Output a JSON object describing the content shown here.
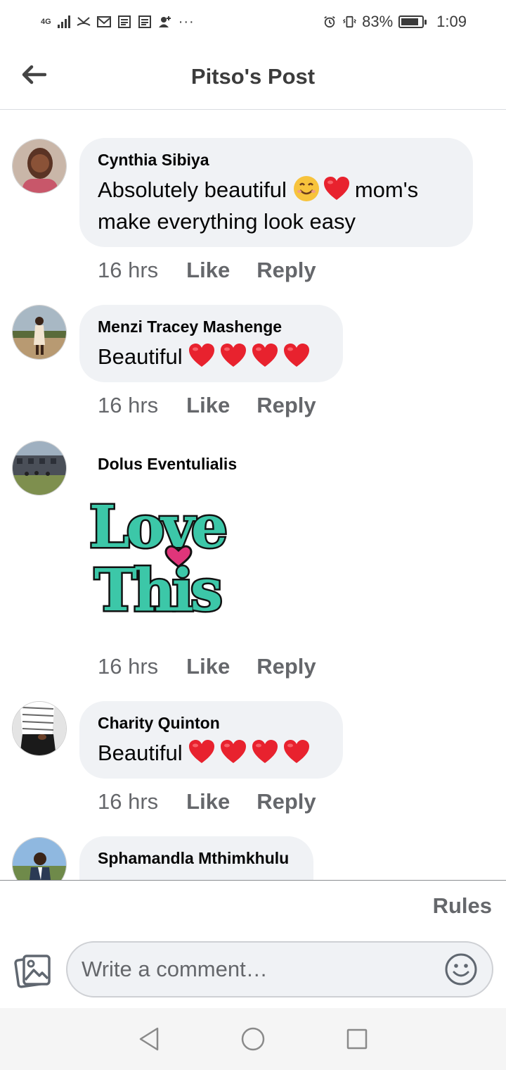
{
  "status_bar": {
    "network": "4G",
    "battery": "83%",
    "time": "1:09",
    "icons": [
      "signal-icon",
      "missed-call-icon",
      "mail-icon",
      "news-icon",
      "news-icon",
      "add-contact-icon",
      "more-icon",
      "alarm-icon",
      "vibrate-icon",
      "battery-icon"
    ]
  },
  "header": {
    "title": "Pitso's Post",
    "back_icon": "back-arrow-icon"
  },
  "comments": [
    {
      "author": "Cynthia Sibiya",
      "text_a": "Absolutely beautiful",
      "text_b": "mom's",
      "text_c": "make everything look easy",
      "time": "16 hrs",
      "like": "Like",
      "reply": "Reply"
    },
    {
      "author": "Menzi Tracey Mashenge",
      "text": "Beautiful",
      "time": "16 hrs",
      "like": "Like",
      "reply": "Reply"
    },
    {
      "author": "Dolus Eventulialis",
      "sticker_line1": "Love",
      "sticker_line2": "This",
      "time": "16 hrs",
      "like": "Like",
      "reply": "Reply"
    },
    {
      "author": "Charity Quinton",
      "text": "Beautiful",
      "time": "16 hrs",
      "like": "Like",
      "reply": "Reply"
    },
    {
      "author": "Sphamandla Mthimkhulu"
    }
  ],
  "composer": {
    "rules_label": "Rules",
    "placeholder": "Write a comment…"
  },
  "colors": {
    "bubble": "#f0f2f5",
    "secondary_text": "#65676b",
    "heart": "#e8222e",
    "sticker_teal": "#3cc7a8"
  }
}
